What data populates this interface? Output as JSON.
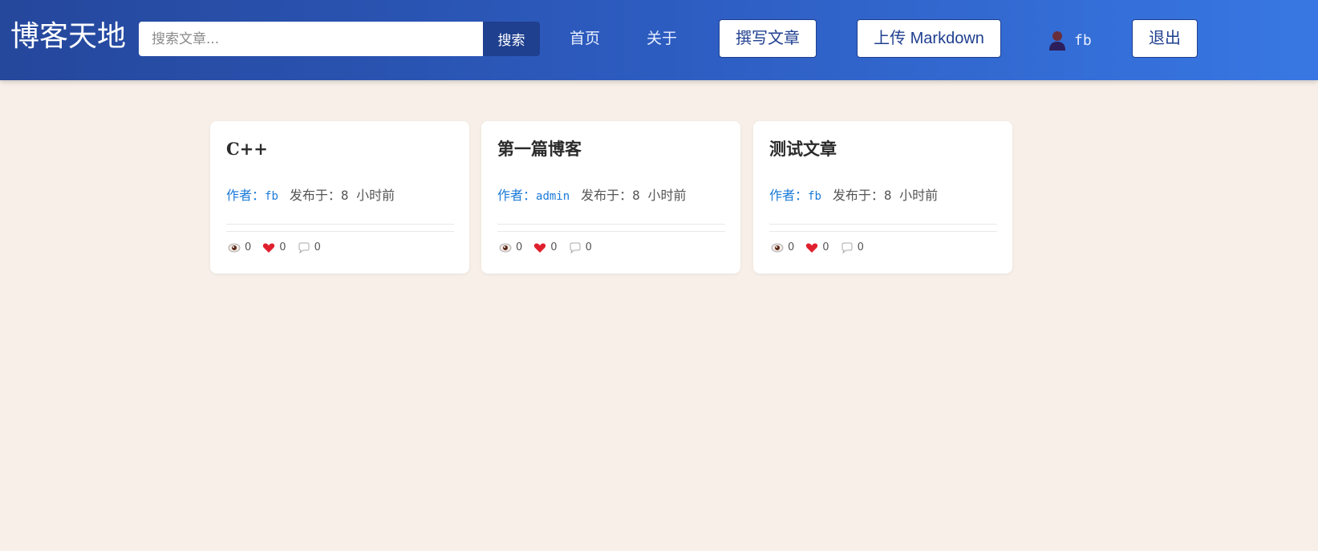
{
  "header": {
    "site_title": "博客天地",
    "search": {
      "placeholder": "搜索文章...",
      "value": "",
      "button_label": "搜索"
    },
    "nav": {
      "home_label": "首页",
      "about_label": "关于"
    },
    "write_button_label": "撰写文章",
    "upload_button_label": "上传 Markdown",
    "user": {
      "name": "fb",
      "icon": "user-icon"
    },
    "logout_button_label": "退出"
  },
  "posts": [
    {
      "title": "C++",
      "author_label": "作者：",
      "author": "fb",
      "published": "发布于：8 小时前",
      "views": "0",
      "likes": "0",
      "comments": "0"
    },
    {
      "title": "第一篇博客",
      "author_label": "作者：",
      "author": "admin",
      "published": "发布于：8 小时前",
      "views": "0",
      "likes": "0",
      "comments": "0"
    },
    {
      "title": "测试文章",
      "author_label": "作者：",
      "author": "fb",
      "published": "发布于：8 小时前",
      "views": "0",
      "likes": "0",
      "comments": "0"
    }
  ],
  "icons": {
    "views": "eye-icon",
    "likes": "heart-icon",
    "comments": "comment-icon"
  },
  "colors": {
    "header_gradient_start": "#25479c",
    "header_gradient_end": "#3877e3",
    "page_background": "#f7efe8",
    "accent_dark": "#1f3f8f",
    "author_link": "#1a7ad8",
    "heart": "#e0202e"
  }
}
